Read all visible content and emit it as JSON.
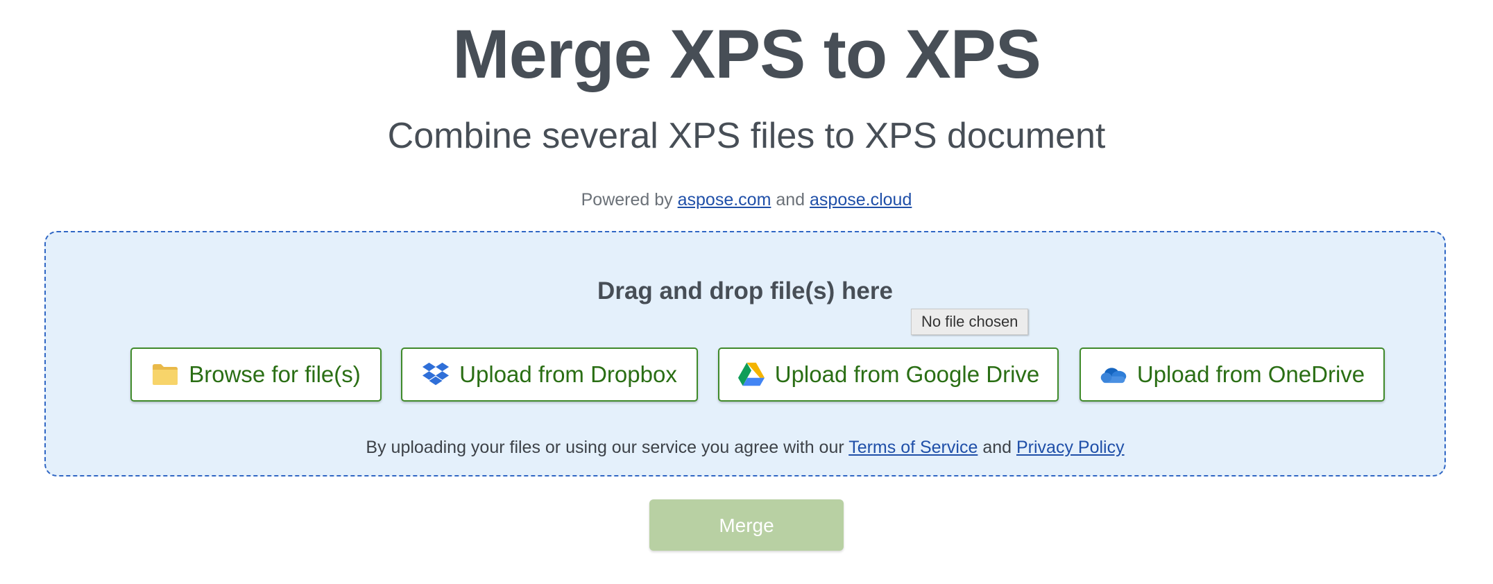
{
  "header": {
    "title": "Merge XPS to XPS",
    "subtitle": "Combine several XPS files to XPS document"
  },
  "powered": {
    "prefix": "Powered by",
    "link1": "aspose.com",
    "conjunction": "and",
    "link2": "aspose.cloud"
  },
  "dropzone": {
    "heading": "Drag and drop file(s) here",
    "tooltip": "No file chosen",
    "buttons": [
      {
        "label": "Browse for file(s)",
        "icon": "folder-icon"
      },
      {
        "label": "Upload from Dropbox",
        "icon": "dropbox-icon"
      },
      {
        "label": "Upload from Google Drive",
        "icon": "google-drive-icon"
      },
      {
        "label": "Upload from OneDrive",
        "icon": "onedrive-icon"
      }
    ],
    "terms": {
      "prefix": "By uploading your files or using our service you agree with our",
      "tos_link": "Terms of Service",
      "conjunction": "and",
      "privacy_link": "Privacy Policy"
    }
  },
  "actions": {
    "merge_label": "Merge"
  },
  "colors": {
    "title": "#474e56",
    "link": "#1f4fa8",
    "dropzone_bg": "#e4f0fb",
    "dropzone_border": "#2f66c4",
    "button_text": "#2a6e14",
    "button_border": "#3f8a2a",
    "merge_disabled": "#b8d0a3"
  }
}
